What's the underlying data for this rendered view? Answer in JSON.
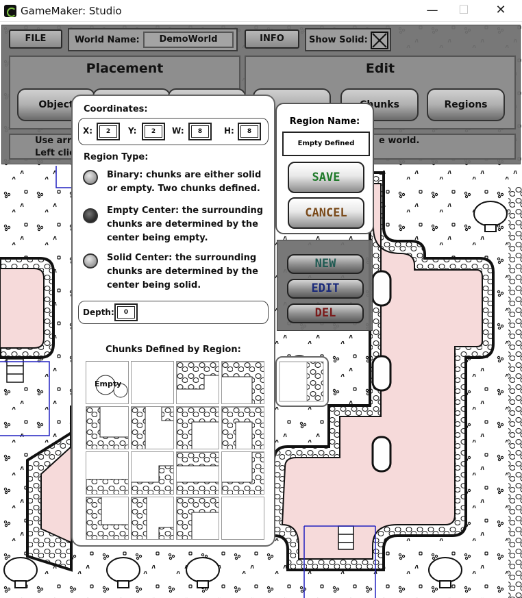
{
  "window": {
    "app_title": "GameMaker: Studio",
    "min_glyph": "—",
    "max_glyph": "☐",
    "close_glyph": "✕"
  },
  "toolbar": {
    "file_label": "FILE",
    "world_name_label": "World Name:",
    "world_name_value": "DemoWorld",
    "info_label": "INFO",
    "show_solid_label": "Show Solid:",
    "show_solid_checked": true
  },
  "placement": {
    "title": "Placement",
    "buttons": [
      "Object",
      "",
      ""
    ]
  },
  "edit": {
    "title": "Edit",
    "buttons": [
      "",
      "Chunks",
      "Regions"
    ]
  },
  "help": {
    "line1_partial": "Use arro",
    "line2_partial": "Left clic",
    "right_partial": "e world."
  },
  "region_card": {
    "name_label": "Region Name:",
    "name_value": "Empty Defined",
    "save_label": "SAVE",
    "cancel_label": "CANCEL",
    "save_color": "#1f7a2a",
    "cancel_color": "#7a4a1a"
  },
  "region_list": {
    "new_label": "NEW",
    "edit_label": "EDIT",
    "del_label": "DEL",
    "new_color": "#1f5a52",
    "edit_color": "#1a2a7a",
    "del_color": "#7a1a1a"
  },
  "dialog": {
    "coordinates_label": "Coordinates:",
    "x_label": "X:",
    "x_value": "2",
    "y_label": "Y:",
    "y_value": "2",
    "w_label": "W:",
    "w_value": "8",
    "h_label": "H:",
    "h_value": "8",
    "region_type_label": "Region Type:",
    "options": [
      {
        "text": "Binary: chunks are either solid or empty. Two chunks defined.",
        "selected": false
      },
      {
        "text": "Empty Center: the surrounding chunks are determined by the center being empty.",
        "selected": true
      },
      {
        "text": "Solid Center: the surrounding chunks are determined by the center being solid.",
        "selected": false
      }
    ],
    "depth_label": "Depth:",
    "depth_value": "0",
    "chunks_label": "Chunks Defined by Region:",
    "first_chunk_caption": "Empty"
  },
  "colors": {
    "panel_gray": "#707070",
    "region_pink": "#f6dada",
    "outline_blue": "#2020c0"
  }
}
